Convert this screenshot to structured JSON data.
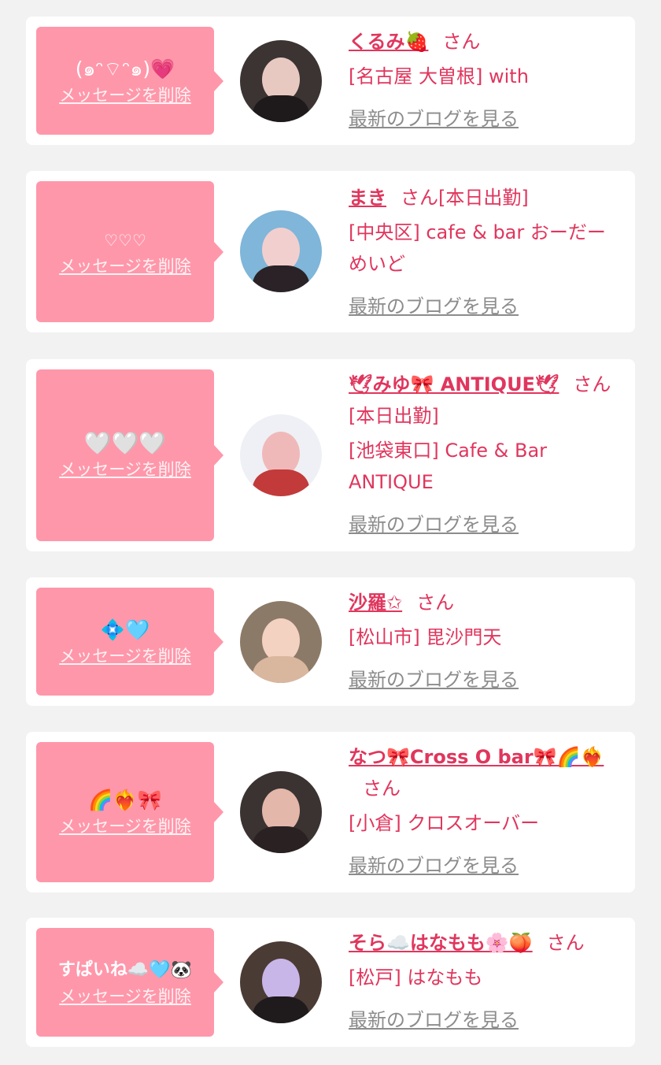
{
  "delete_label": "メッセージを削除",
  "blog_label": "最新のブログを見る",
  "san_label": "さん",
  "items": [
    {
      "message": "(๑ᵔ⌔ᵔ๑)💗",
      "name": "くるみ🍓",
      "status": "",
      "shop": "[名古屋 大曽根] with",
      "avatar_colors": {
        "bg": "#3b3433",
        "face": "#e8c9c1",
        "body": "#1e1a1c"
      }
    },
    {
      "message": "♡♡♡",
      "name": "まき",
      "status": "[本日出勤]",
      "shop": "[中央区] cafe & bar おーだーめいど",
      "avatar_colors": {
        "bg": "#7fb6d9",
        "face": "#f2cfcf",
        "body": "#2a2226"
      }
    },
    {
      "message": "🤍🤍🤍",
      "name": "🕊みゆ🎀 ANTIQUE🕊",
      "status": "[本日出勤]",
      "shop": "[池袋東口] Cafe & Bar ANTIQUE",
      "avatar_colors": {
        "bg": "#eef0f5",
        "face": "#f0b9b9",
        "body": "#c23a3a"
      }
    },
    {
      "message": "💠🩵",
      "name": "沙羅✩",
      "status": "",
      "shop": "[松山市] 毘沙門天",
      "avatar_colors": {
        "bg": "#8c7a68",
        "face": "#f3d2c2",
        "body": "#d9b79f"
      }
    },
    {
      "message": "🌈❤️‍🔥🎀",
      "name": "なつ🎀Cross O bar🎀🌈❤️‍🔥",
      "status": "",
      "shop": "[小倉] クロスオーバー",
      "avatar_colors": {
        "bg": "#3a3332",
        "face": "#e3b7a9",
        "body": "#2a2222"
      }
    },
    {
      "message": "すぱいね☁️🩵🐼",
      "name": "そら☁️はなもも🌸🍑",
      "status": "",
      "shop": "[松戸] はなもも",
      "avatar_colors": {
        "bg": "#4b3b35",
        "face": "#c9b6e8",
        "body": "#1f1a1c"
      }
    }
  ]
}
